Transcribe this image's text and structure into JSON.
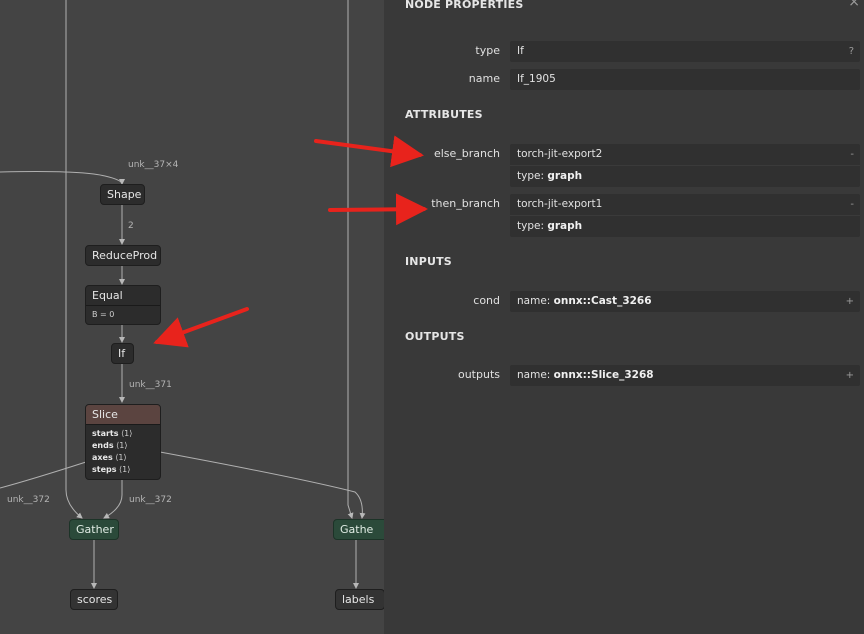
{
  "graph": {
    "edge_labels": {
      "shape_in": "unk__37×4",
      "shape_out": "2",
      "if_out": "unk__371",
      "slice_left": "unk__372",
      "slice_down": "unk__372"
    },
    "nodes": {
      "shape": "Shape",
      "reduceprod": "ReduceProd",
      "equal": "Equal",
      "equal_attr": "B = 0",
      "if": "If",
      "slice": "Slice",
      "slice_attrs": [
        {
          "name": "starts",
          "value": "⟨1⟩"
        },
        {
          "name": "ends",
          "value": "⟨1⟩"
        },
        {
          "name": "axes",
          "value": "⟨1⟩"
        },
        {
          "name": "steps",
          "value": "⟨1⟩"
        }
      ],
      "gather_left": "Gather",
      "gather_right": "Gathe",
      "scores": "scores",
      "labels": "labels"
    }
  },
  "panel": {
    "title": "NODE PROPERTIES",
    "close_glyph": "×",
    "type_label": "type",
    "type_value": "If",
    "type_help": "?",
    "name_label": "name",
    "name_value": "If_1905",
    "attributes_title": "ATTRIBUTES",
    "else_label": "else_branch",
    "else_value": "torch-jit-export2",
    "else_type_prefix": "type:",
    "else_type_value": "graph",
    "then_label": "then_branch",
    "then_value": "torch-jit-export1",
    "then_type_prefix": "type:",
    "then_type_value": "graph",
    "collapse_glyph": "-",
    "inputs_title": "INPUTS",
    "cond_label": "cond",
    "cond_prefix": "name:",
    "cond_value": "onnx::Cast_3266",
    "outputs_title": "OUTPUTS",
    "outputs_label": "outputs",
    "outputs_prefix": "name:",
    "outputs_value": "onnx::Slice_3268",
    "expand_glyph": "+"
  },
  "colors": {
    "graph_bg": "#444444",
    "panel_bg": "#393939",
    "arrow": "#e8231c",
    "gather": "#2b4a3a",
    "slice_header": "#5b4440"
  }
}
